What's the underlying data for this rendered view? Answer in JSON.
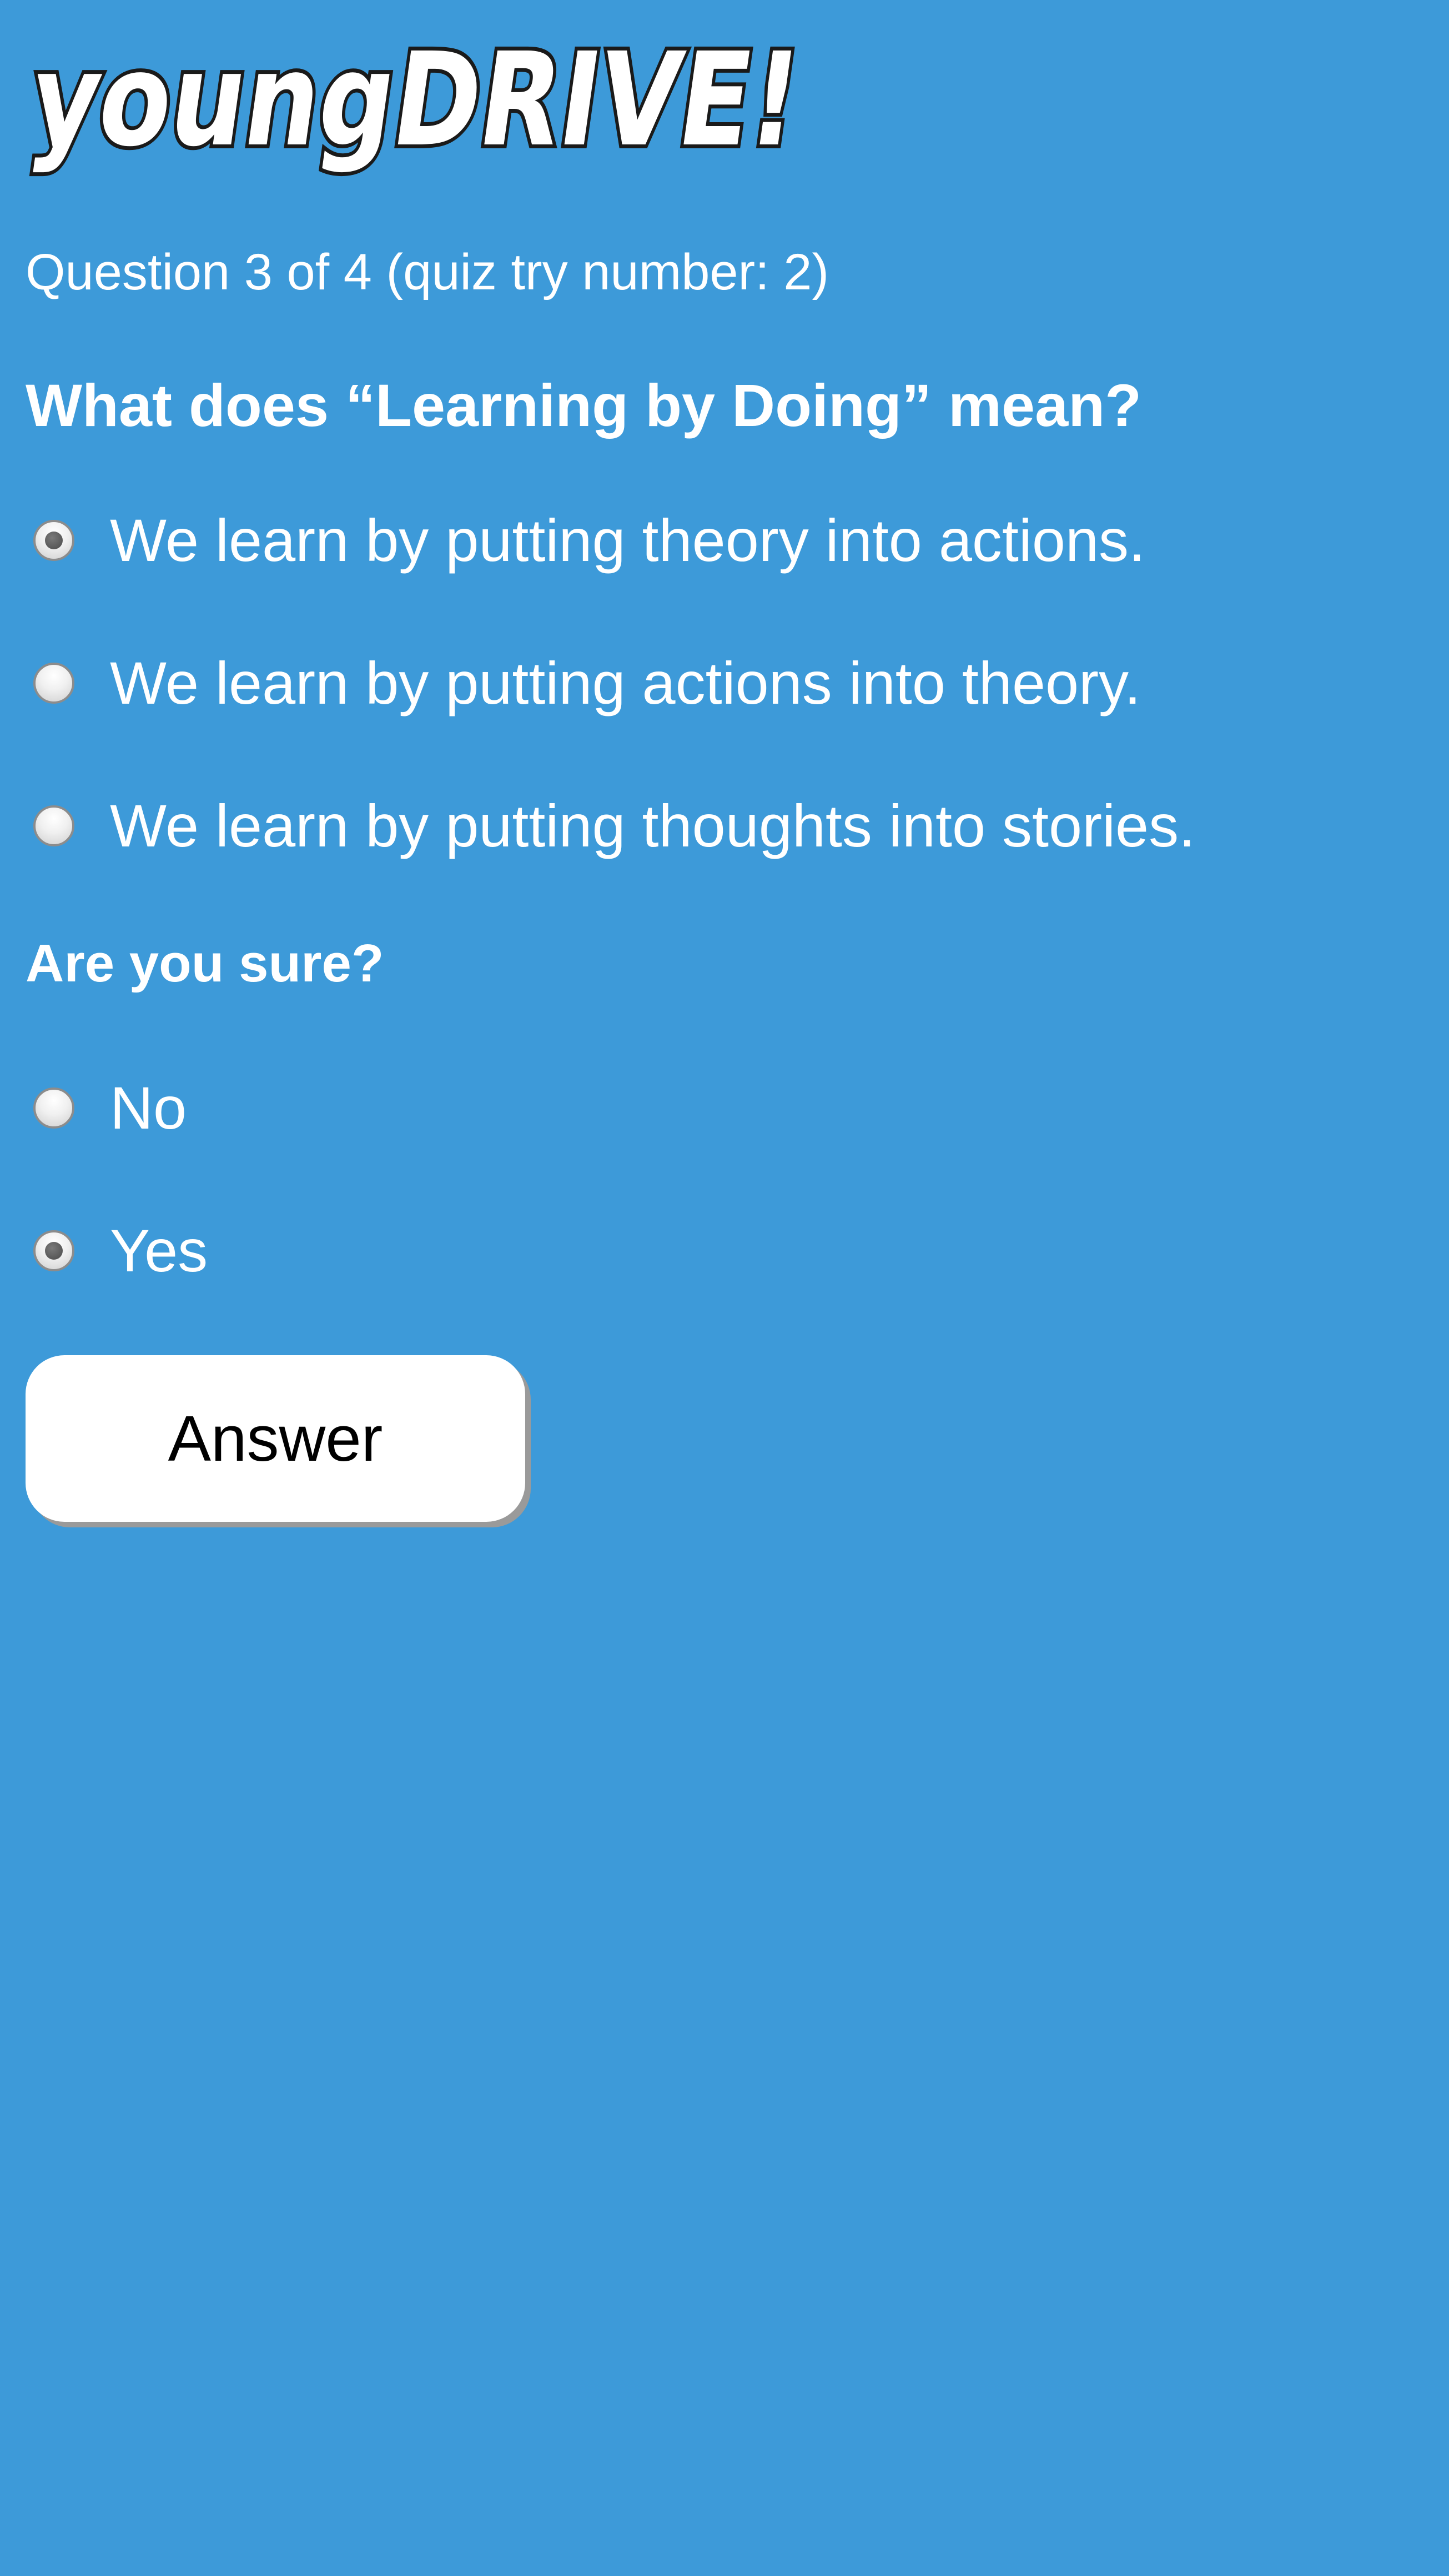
{
  "brand": {
    "logo_text": "youngDRIVE!",
    "logo_colors": {
      "text_fill": "#ffffff",
      "outline": "#1a1a1a"
    }
  },
  "quiz": {
    "progress_text": "Question 3 of 4 (quiz try number: 2)",
    "question_text": "What does “Learning by Doing” mean?",
    "options": [
      {
        "label": "We learn by putting theory into actions.",
        "selected": true
      },
      {
        "label": "We learn by putting actions into theory.",
        "selected": false
      },
      {
        "label": "We learn by putting thoughts into stories.",
        "selected": false
      }
    ],
    "confirm_question": "Are you sure?",
    "confirm_options": [
      {
        "label": "No",
        "selected": false
      },
      {
        "label": "Yes",
        "selected": true
      }
    ],
    "submit_label": "Answer"
  },
  "colors": {
    "background": "#3d9ad9",
    "text": "#ffffff",
    "button_background": "#ffffff",
    "button_text": "#000000",
    "button_shadow": "#9a9a9a"
  }
}
